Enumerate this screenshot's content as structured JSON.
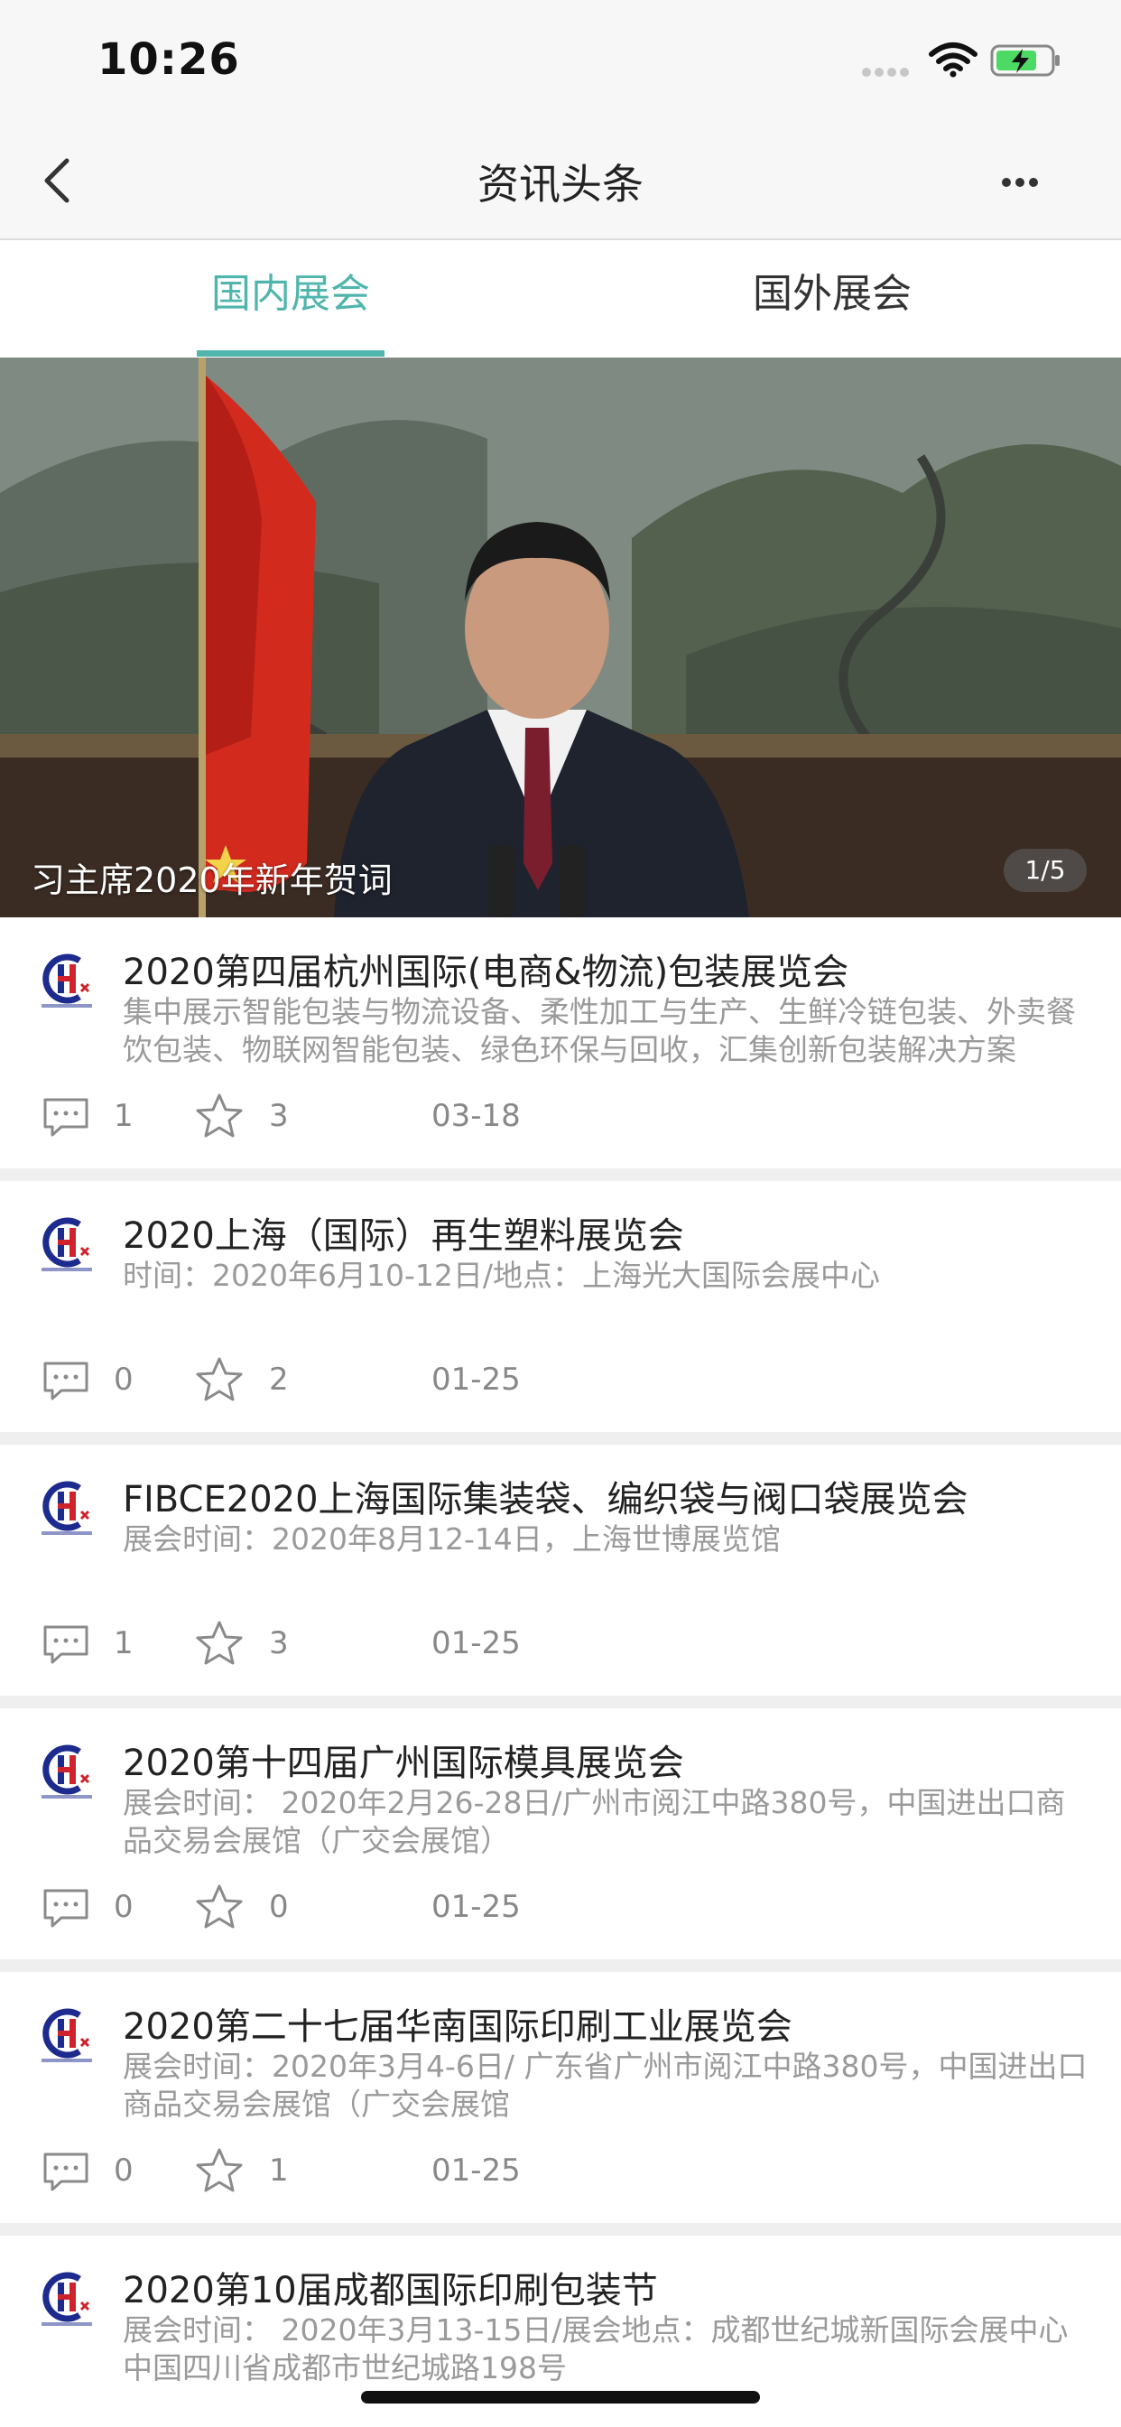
{
  "status_bar": {
    "time": "10:26"
  },
  "nav": {
    "title": "资讯头条"
  },
  "tabs": [
    {
      "label": "国内展会",
      "active": true
    },
    {
      "label": "国外展会",
      "active": false
    }
  ],
  "banner": {
    "caption": "习主席2020年新年贺词",
    "counter": "1/5"
  },
  "colors": {
    "accent": "#4fb5ad",
    "logo_blue": "#1d2b8f",
    "logo_red": "#d0222a"
  },
  "news": [
    {
      "title": "2020第四届杭州国际(电商&物流)包装展览会",
      "desc": "集中展示智能包装与物流设备、柔性加工与生产、生鲜冷链包装、外卖餐饮包装、物联网智能包装、绿色环保与回收，汇集创新包装解决方案",
      "comments": "1",
      "stars": "3",
      "date": "03-18"
    },
    {
      "title": "2020上海（国际）再生塑料展览会",
      "desc": "时间：2020年6月10-12日/地点：上海光大国际会展中心",
      "comments": "0",
      "stars": "2",
      "date": "01-25"
    },
    {
      "title": "FIBCE2020上海国际集装袋、编织袋与阀口袋展览会",
      "desc": "展会时间：2020年8月12-14日，上海世博展览馆",
      "comments": "1",
      "stars": "3",
      "date": "01-25"
    },
    {
      "title": "2020第十四届广州国际模具展览会",
      "desc": "展会时间： 2020年2月26-28日/广州市阅江中路380号，中国进出口商品交易会展馆（广交会展馆）",
      "comments": "0",
      "stars": "0",
      "date": "01-25"
    },
    {
      "title": "2020第二十七届华南国际印刷工业展览会",
      "desc": "展会时间：2020年3月4-6日/ 广东省广州市阅江中路380号，中国进出口商品交易会展馆（广交会展馆",
      "comments": "0",
      "stars": "1",
      "date": "01-25"
    },
    {
      "title": "2020第10届成都国际印刷包装节",
      "desc": "展会时间： 2020年3月13-15日/展会地点：成都世纪城新国际会展中心 中国四川省成都市世纪城路198号",
      "comments": "",
      "stars": "",
      "date": ""
    }
  ]
}
